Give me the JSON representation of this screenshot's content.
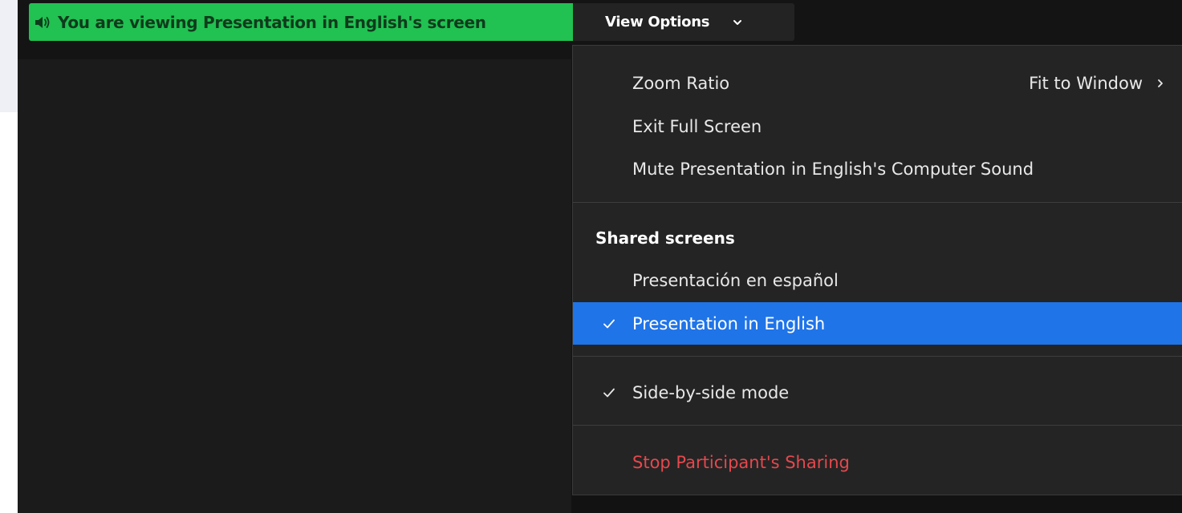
{
  "banner": {
    "text": "You are viewing Presentation in English's screen",
    "icon": "speaker-icon",
    "color": "#21c152"
  },
  "view_options": {
    "label": "View Options",
    "icon": "chevron-down-icon"
  },
  "menu": {
    "zoom_ratio": {
      "label": "Zoom Ratio",
      "value": "Fit to Window",
      "icon": "chevron-right-icon"
    },
    "exit_full_screen": {
      "label": "Exit Full Screen"
    },
    "mute_sound": {
      "label": "Mute Presentation in English's Computer Sound"
    },
    "shared_screens_header": "Shared screens",
    "shared_screens": [
      {
        "label": "Presentación en español",
        "checked": false
      },
      {
        "label": "Presentation in English",
        "checked": true
      }
    ],
    "side_by_side": {
      "label": "Side-by-side mode",
      "checked": true
    },
    "stop_sharing": {
      "label": "Stop Participant's Sharing",
      "color": "#e5484d"
    },
    "selected_color": "#1f74e8"
  }
}
